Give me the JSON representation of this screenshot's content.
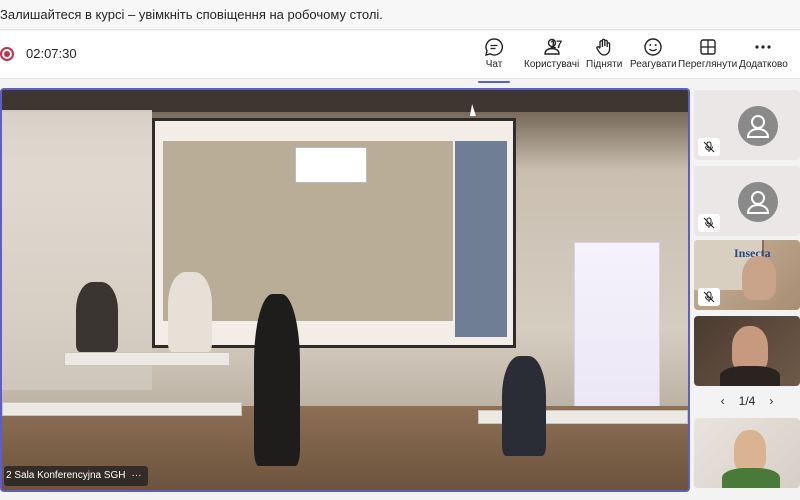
{
  "notification": {
    "text": "Залишайтеся в курсі – увімкніть сповіщення на робочому столі."
  },
  "meeting": {
    "timer": "02:07:30"
  },
  "toolbar": {
    "chat": "Чат",
    "people": "Користувачі",
    "people_count": "17",
    "raise": "Підняти",
    "react": "Реагувати",
    "view": "Переглянути",
    "more": "Додатково"
  },
  "stage": {
    "label": "2 Sala Konferencyjna SGH",
    "more": "···"
  },
  "pager": {
    "prev": "‹",
    "text": "1/4",
    "next": "›"
  },
  "tiles": {
    "insecta_label": "Insecta"
  },
  "colors": {
    "accent": "#5b5fc7",
    "record": "#c4314b"
  },
  "icons": [
    "record-icon",
    "chat-icon",
    "people-icon",
    "hand-icon",
    "smile-icon",
    "grid-icon",
    "more-icon",
    "mic-off-icon",
    "avatar-icon"
  ]
}
